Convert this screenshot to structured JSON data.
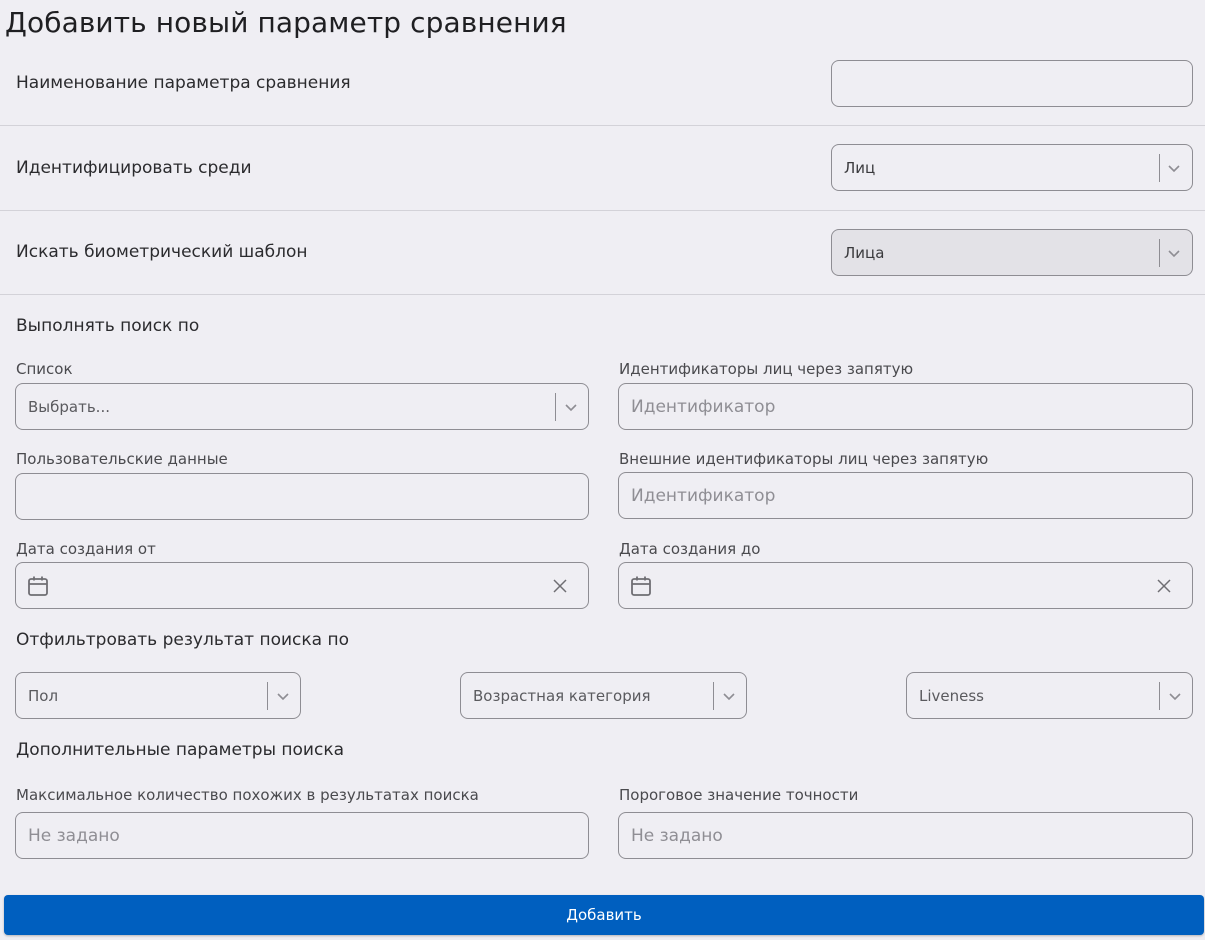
{
  "page": {
    "title": "Добавить новый параметр сравнения"
  },
  "rows": {
    "name": {
      "label": "Наименование параметра сравнения",
      "value": ""
    },
    "identify_among": {
      "label": "Идентифицировать среди",
      "value": "Лиц"
    },
    "biometric_template": {
      "label": "Искать биометрический шаблон",
      "value": "Лица",
      "disabled": true
    }
  },
  "search_by": {
    "heading": "Выполнять поиск по",
    "list": {
      "label": "Список",
      "placeholder": "Выбрать..."
    },
    "face_ids": {
      "label": "Идентификаторы лиц через запятую",
      "placeholder": "Идентификатор"
    },
    "user_data": {
      "label": "Пользовательские данные",
      "value": ""
    },
    "external_ids": {
      "label": "Внешние идентификаторы лиц через запятую",
      "placeholder": "Идентификатор"
    },
    "created_from": {
      "label": "Дата создания от",
      "value": ""
    },
    "created_to": {
      "label": "Дата создания до",
      "value": ""
    }
  },
  "filter": {
    "heading": "Отфильтровать результат поиска по",
    "gender": {
      "placeholder": "Пол"
    },
    "age_category": {
      "placeholder": "Возрастная категория"
    },
    "liveness": {
      "placeholder": "Liveness"
    }
  },
  "extra": {
    "heading": "Дополнительные параметры поиска",
    "max_similar": {
      "label": "Максимальное количество похожих в результатах поиска",
      "placeholder": "Не задано"
    },
    "threshold": {
      "label": "Пороговое значение точности",
      "placeholder": "Не задано"
    }
  },
  "actions": {
    "add_label": "Добавить"
  },
  "colors": {
    "background": "#efeef3",
    "primary": "#005fbf",
    "border": "#8e8d93",
    "disabled_bg": "#e3e2e7"
  }
}
